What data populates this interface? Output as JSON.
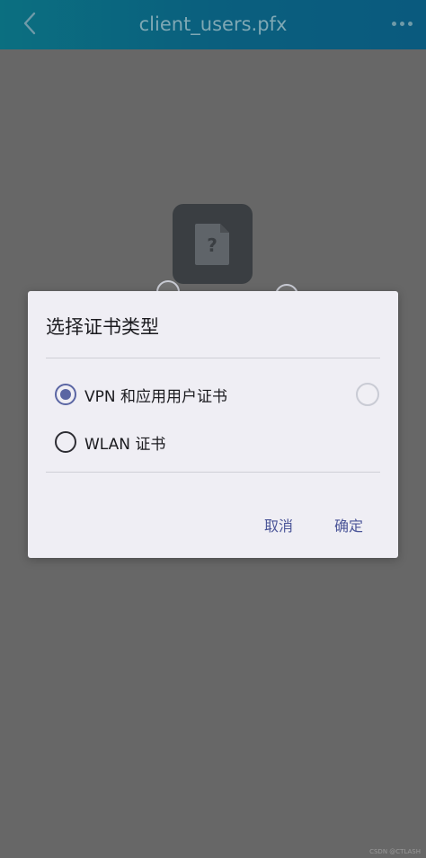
{
  "app_bar": {
    "title": "client_users.pfx",
    "back_icon": "chevron-left-icon",
    "more_icon": "more-horizontal-icon"
  },
  "file": {
    "icon": "unknown-file-icon",
    "glyph": "?"
  },
  "dialog": {
    "title": "选择证书类型",
    "options": [
      {
        "label": "VPN 和应用用户证书",
        "selected": true
      },
      {
        "label": "WLAN 证书",
        "selected": false
      }
    ],
    "cancel_label": "取消",
    "confirm_label": "确定"
  },
  "watermark": "CSDN @CTLASH",
  "colors": {
    "accent": "#5a65a3",
    "app_bar": "#0a5f7e",
    "scrim": "#676767",
    "dialog_bg": "#efeef4"
  }
}
